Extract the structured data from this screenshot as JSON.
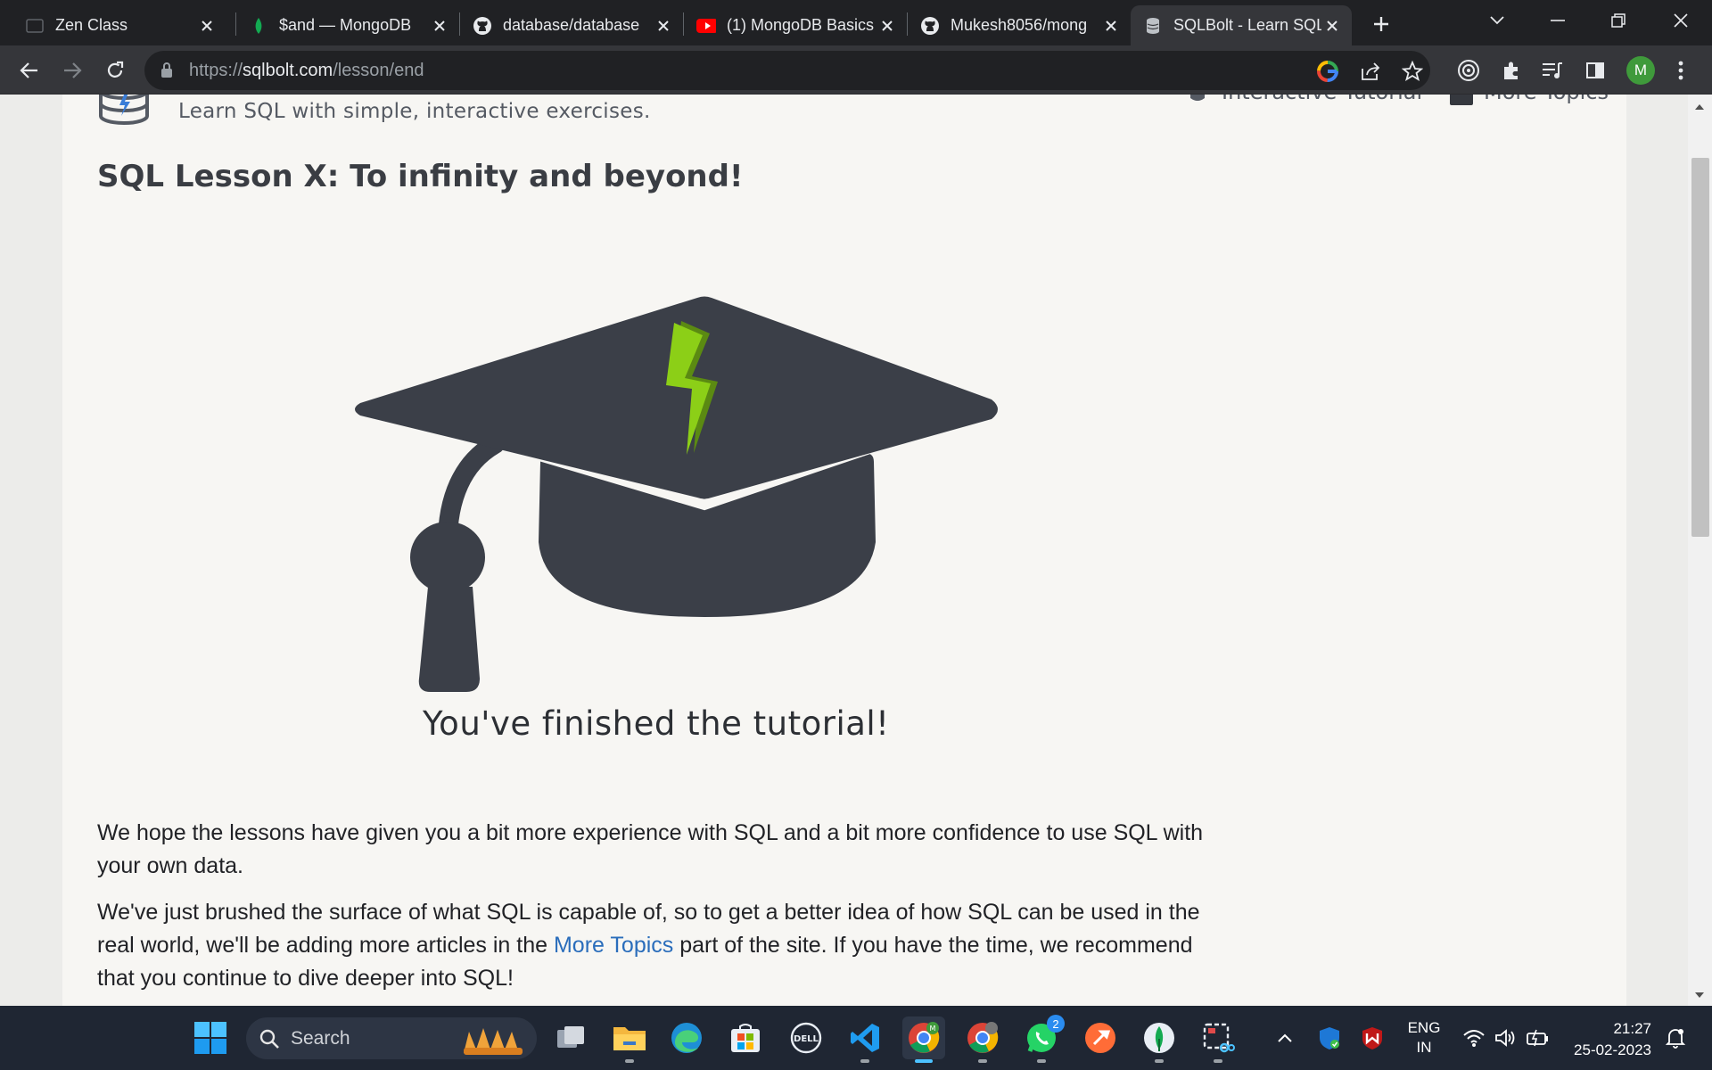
{
  "browser": {
    "tabs": [
      {
        "title": "Zen Class",
        "icon": "zen-class-favicon",
        "active": false
      },
      {
        "title": "$and — MongoDB",
        "icon": "mongodb-leaf-icon",
        "active": false
      },
      {
        "title": "database/database",
        "icon": "github-icon",
        "active": false
      },
      {
        "title": "(1) MongoDB Basics",
        "icon": "youtube-icon",
        "active": false
      },
      {
        "title": "Mukesh8056/mong",
        "icon": "github-icon",
        "active": false
      },
      {
        "title": "SQLBolt - Learn SQL",
        "icon": "sqlbolt-favicon",
        "active": true
      }
    ],
    "url_prefix": "https://",
    "url_domain": "sqlbolt.com",
    "url_path": "/lesson/end",
    "profile_initial": "M"
  },
  "page": {
    "tagline": "Learn SQL with simple, interactive exercises.",
    "nav": {
      "interactive_tutorial": "Interactive Tutorial",
      "more_topics": "More Topics"
    },
    "lesson_title": "SQL Lesson X: To infinity and beyond!",
    "finished": "You've finished the tutorial!",
    "para1": "We hope the lessons have given you a bit more experience with SQL and a bit more confidence to use SQL with your own data.",
    "para2_before": "We've just brushed the surface of what SQL is capable of, so to get a better idea of how SQL can be used in the real world, we'll be adding more articles in the ",
    "para2_link": "More Topics",
    "para2_after": " part of the site. If you have the time, we recommend that you continue to dive deeper into SQL!"
  },
  "taskbar": {
    "search_label": "Search",
    "apps": [
      "start-icon",
      "file-explorer-icon",
      "task-view-icon",
      "folder-icon",
      "edge-icon",
      "microsoft-store-icon",
      "dell-icon",
      "vscode-icon",
      "chrome-icon",
      "chrome-profile-icon",
      "whatsapp-icon",
      "postman-icon",
      "mongodb-compass-icon",
      "snipping-tool-icon"
    ],
    "whatsapp_badge": "2",
    "lang_line1": "ENG",
    "lang_line2": "IN",
    "time": "21:27",
    "date": "25-02-2023"
  },
  "colors": {
    "lightning": "#8ccf17",
    "cap": "#3b3f48",
    "link": "#2a6dbb",
    "tab_strip": "#202124",
    "taskbar": "#1f2633"
  }
}
